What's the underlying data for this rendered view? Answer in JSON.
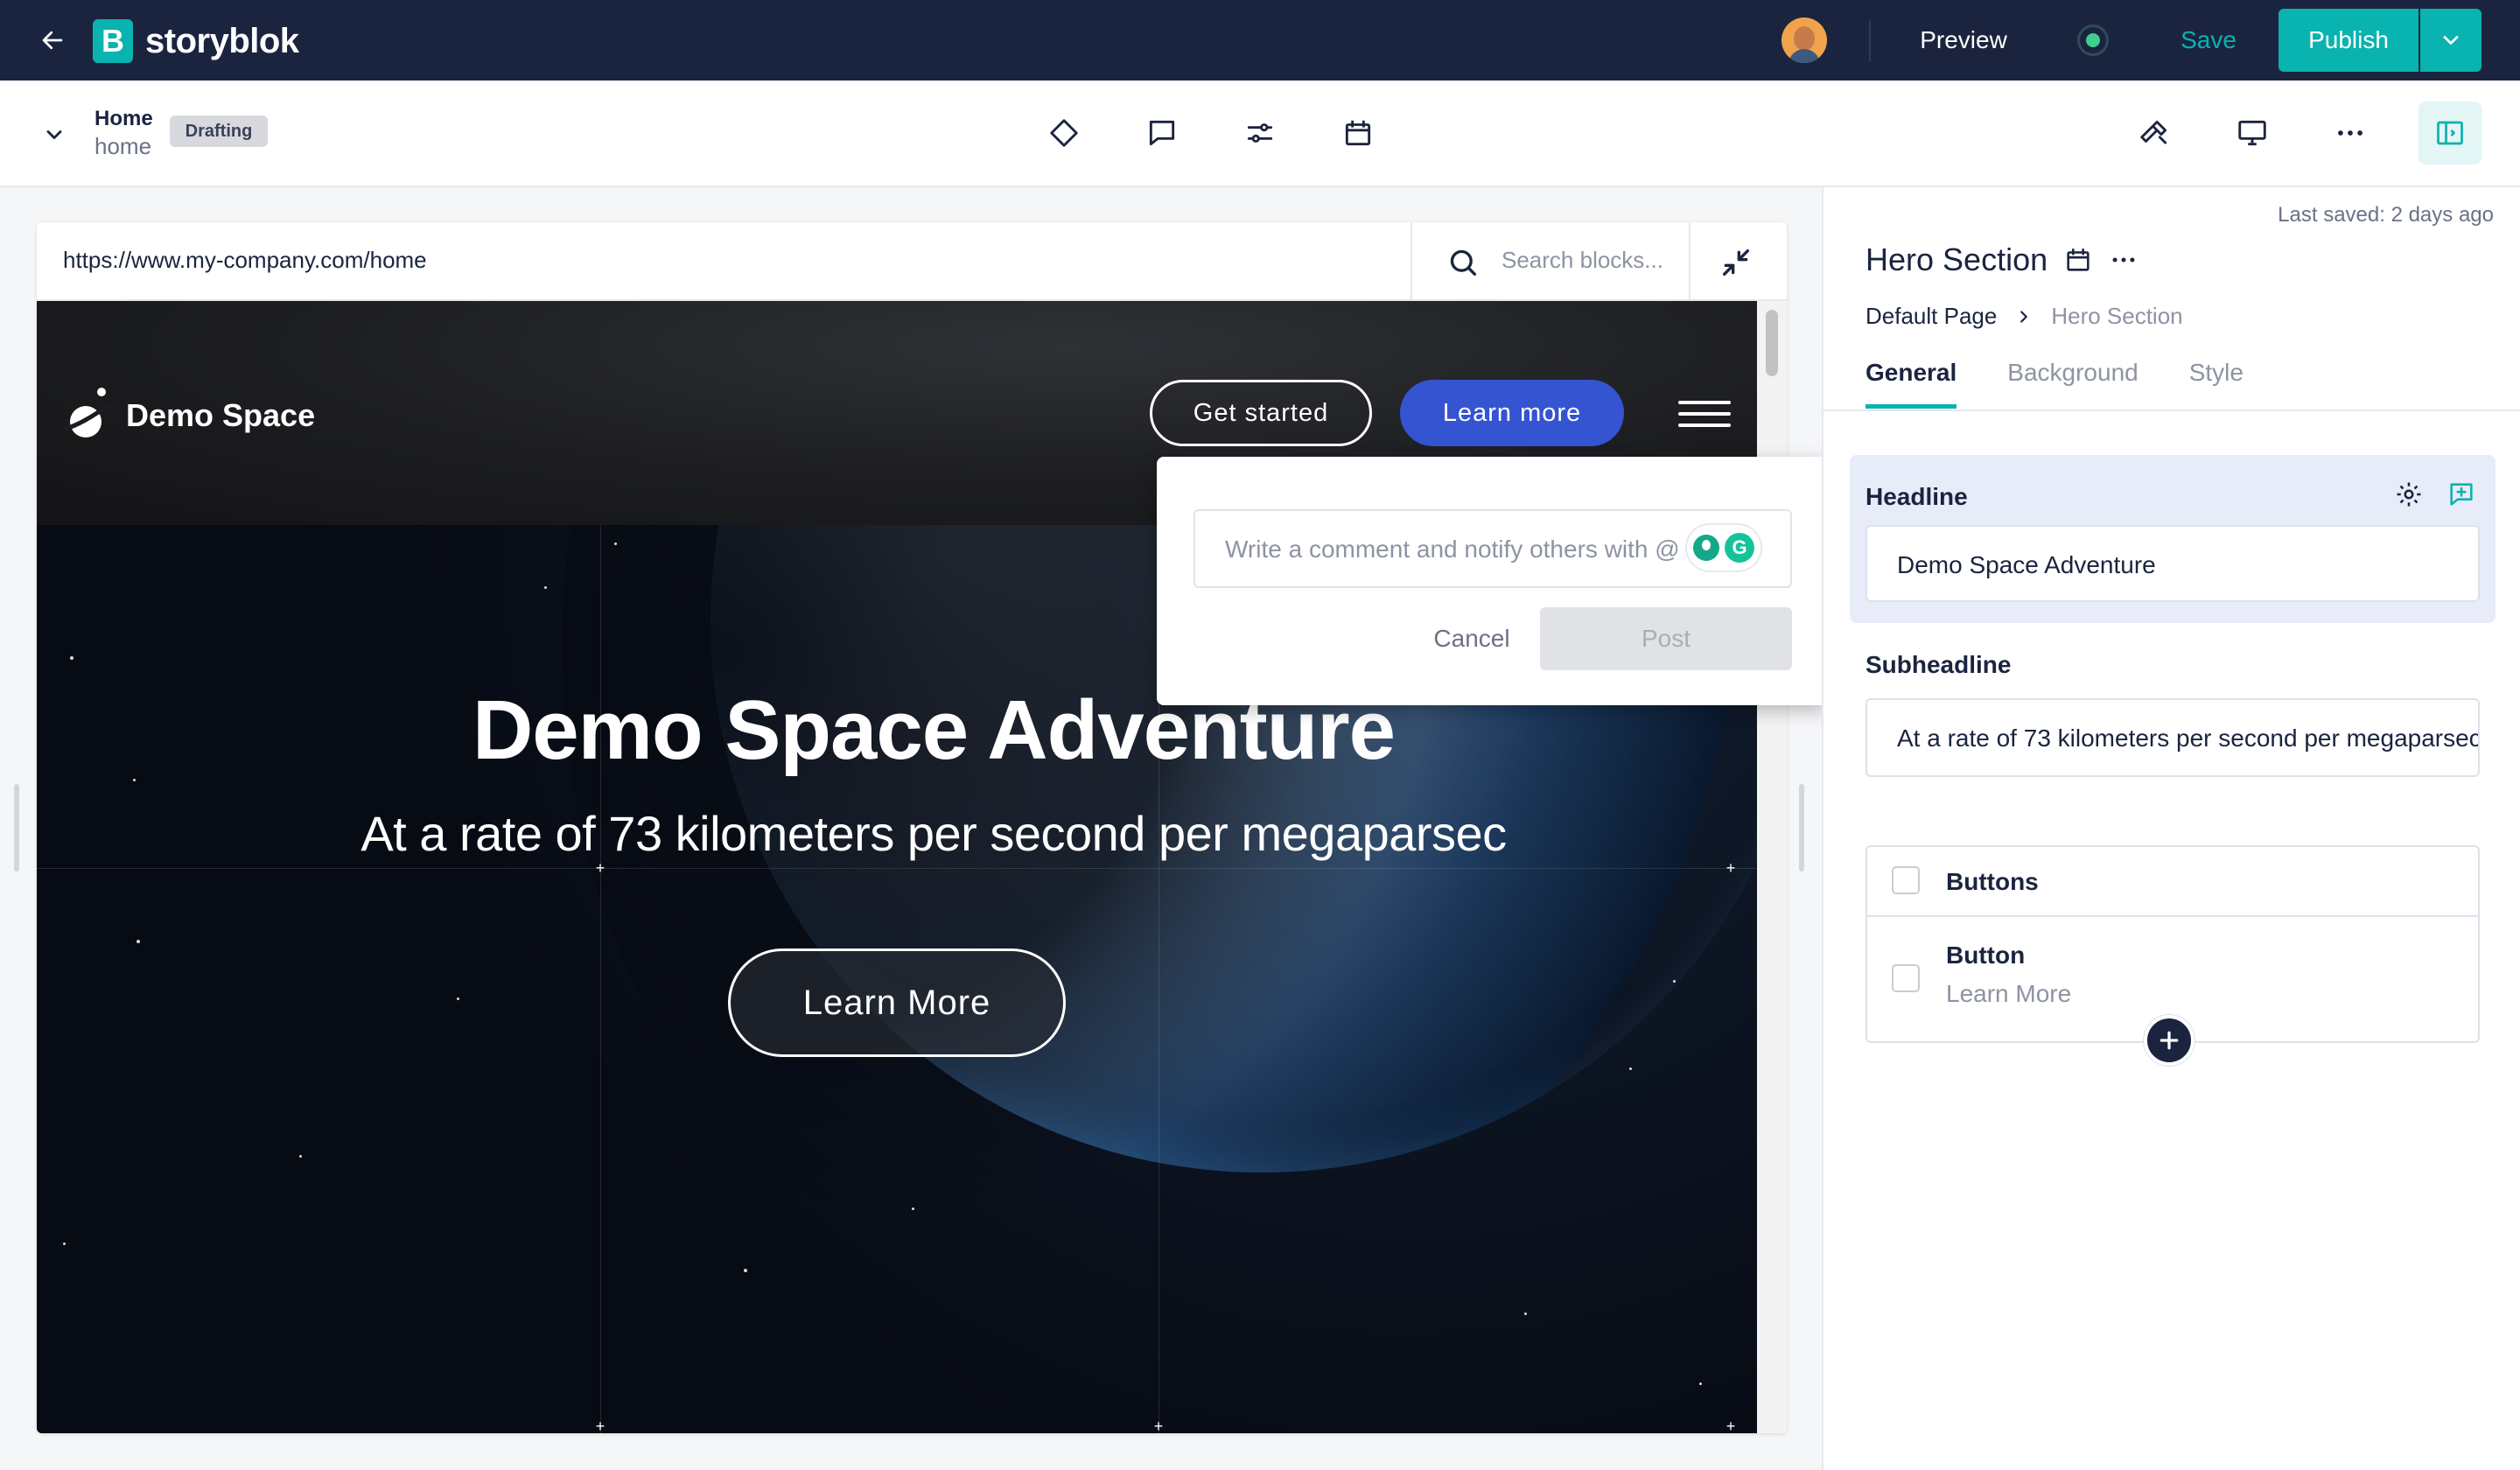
{
  "app": {
    "name": "storyblok",
    "logo_letter": "B",
    "colors": {
      "brand": "#09b3af",
      "topbar": "#1b243f",
      "accent_blue": "#3554d1"
    }
  },
  "topbar": {
    "preview_label": "Preview",
    "save_label": "Save",
    "publish_label": "Publish"
  },
  "story": {
    "title": "Home",
    "slug": "home",
    "status": "Drafting"
  },
  "preview": {
    "url": "https://www.my-company.com/home",
    "search_placeholder": "Search blocks..."
  },
  "site": {
    "logo_text": "Demo Space",
    "nav": {
      "get_started": "Get started",
      "learn_more": "Learn more"
    },
    "hero": {
      "headline": "Demo Space Adventure",
      "subheadline": "At a rate of 73 kilometers per second per megaparsec",
      "button": "Learn More"
    }
  },
  "comment": {
    "placeholder": "Write a comment and notify others with @",
    "grammarly_letter": "G",
    "cancel": "Cancel",
    "post": "Post"
  },
  "panel": {
    "last_saved": "Last saved: 2 days ago",
    "title": "Hero Section",
    "breadcrumb": {
      "root": "Default Page",
      "current": "Hero Section"
    },
    "tabs": [
      {
        "label": "General",
        "active": true
      },
      {
        "label": "Background",
        "active": false
      },
      {
        "label": "Style",
        "active": false
      }
    ],
    "fields": {
      "headline_label": "Headline",
      "headline_value": "Demo Space Adventure",
      "subheadline_label": "Subheadline",
      "subheadline_value": "At a rate of 73 kilometers per second per megaparsec"
    },
    "blocks": {
      "title": "Buttons",
      "items": [
        {
          "name": "Button",
          "value": "Learn More"
        }
      ]
    }
  }
}
